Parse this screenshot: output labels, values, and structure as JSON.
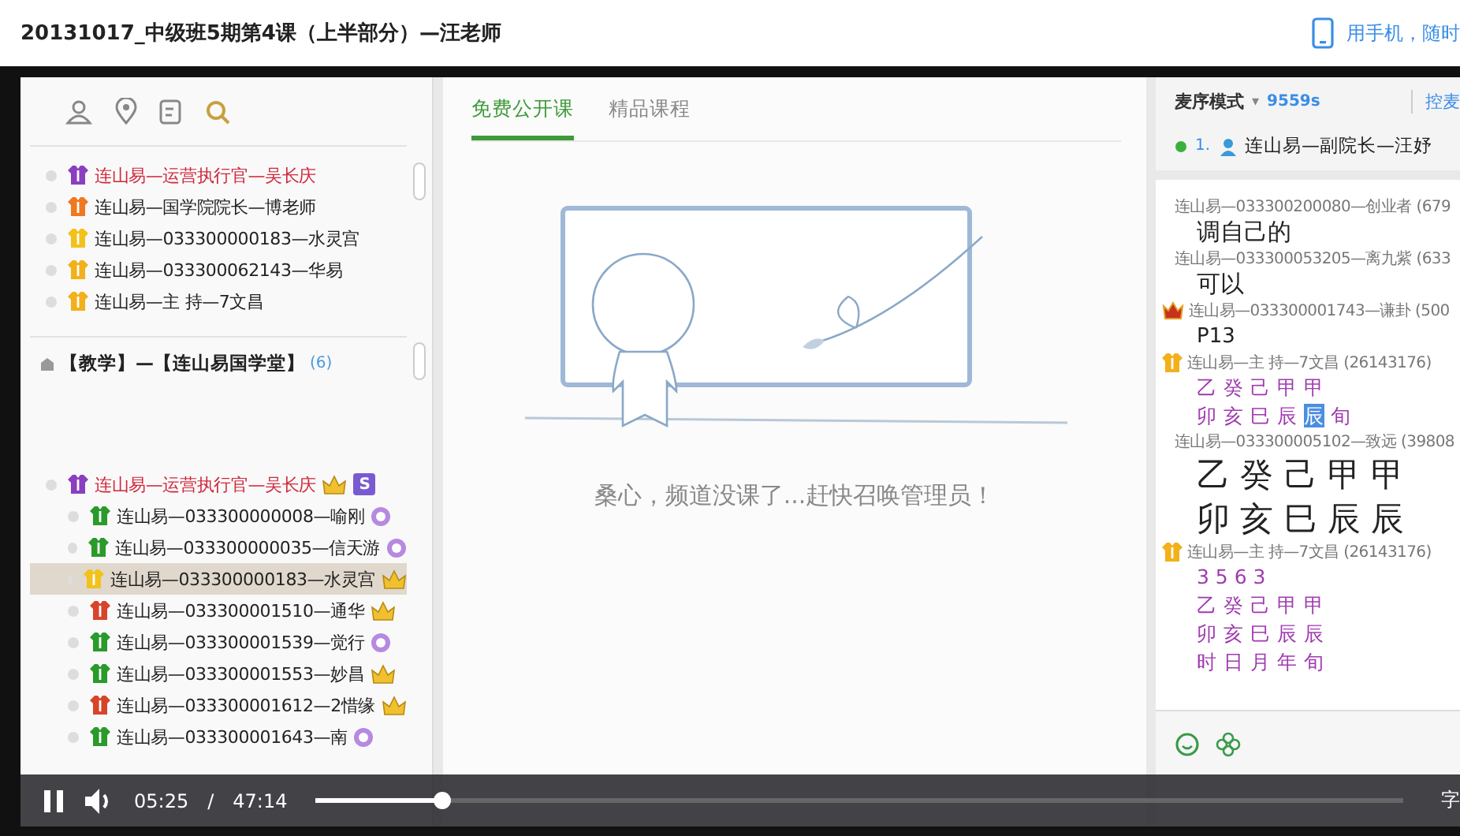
{
  "window": {
    "title": "20131017_中级班5期第4课（上半部分）—汪老师",
    "mobile_link": "用手机，随时"
  },
  "left_panel": {
    "group_1": [
      {
        "name": "连山易—运营执行官—吴长庆",
        "color": "#8a3fc0",
        "admin": true,
        "selected": false
      },
      {
        "name": "连山易—国学院院长—博老师",
        "color": "#f07820",
        "admin": false,
        "selected": false
      },
      {
        "name": "连山易—033300000183—水灵宫",
        "color": "#f2c21a",
        "admin": false,
        "selected": false
      },
      {
        "name": "连山易—033300062143—华易",
        "color": "#f2b01a",
        "admin": false,
        "selected": false
      },
      {
        "name": "连山易—主 持—7文昌",
        "color": "#f2b01a",
        "admin": false,
        "selected": false
      }
    ],
    "section": {
      "title": "【教学】—【连山易国学堂】",
      "count": "(6)"
    },
    "group_2": [
      {
        "name": "连山易—运营执行官—吴长庆",
        "color": "#8a3fc0",
        "admin": true,
        "selected": false,
        "badges": [
          {
            "kind": "crown"
          },
          {
            "kind": "letter",
            "text": "S"
          }
        ]
      },
      {
        "name": "连山易—033300000008—喻刚",
        "color": "#2a9a2a",
        "admin": false,
        "selected": false,
        "badges": [
          {
            "kind": "medal"
          }
        ]
      },
      {
        "name": "连山易—033300000035—信天游",
        "color": "#2a9a2a",
        "admin": false,
        "selected": false,
        "badges": [
          {
            "kind": "medal"
          }
        ]
      },
      {
        "name": "连山易—033300000183—水灵宫",
        "color": "#f2c21a",
        "admin": false,
        "selected": true,
        "badges": [
          {
            "kind": "crown"
          }
        ]
      },
      {
        "name": "连山易—033300001510—通华",
        "color": "#d8442a",
        "admin": false,
        "selected": false,
        "badges": [
          {
            "kind": "crown"
          }
        ]
      },
      {
        "name": "连山易—033300001539—觉行",
        "color": "#2a9a2a",
        "admin": false,
        "selected": false,
        "badges": [
          {
            "kind": "medal"
          }
        ]
      },
      {
        "name": "连山易—033300001553—妙昌",
        "color": "#2a9a2a",
        "admin": false,
        "selected": false,
        "badges": [
          {
            "kind": "crown"
          }
        ]
      },
      {
        "name": "连山易—033300001612—2惜缘",
        "color": "#d8442a",
        "admin": false,
        "selected": false,
        "badges": [
          {
            "kind": "crown"
          }
        ]
      },
      {
        "name": "连山易—033300001643—南",
        "color": "#2a9a2a",
        "admin": false,
        "selected": false,
        "badges": [
          {
            "kind": "medal"
          }
        ]
      }
    ]
  },
  "center": {
    "tabs": [
      {
        "label": "免费公开课",
        "selected": true
      },
      {
        "label": "精品课程",
        "selected": false
      }
    ],
    "empty_message": "桑心，频道没课了...赶快召唤管理员！"
  },
  "right_panel": {
    "mode": "麦序模式",
    "mode_caret": "▾",
    "timer": "9559s",
    "control": "控麦",
    "speaker": {
      "rank": "1.",
      "name": "连山易—副院长—汪妤"
    },
    "messages": [
      {
        "kind": "plain",
        "sender": "连山易—033300200080—创业者 (679",
        "lines": [
          {
            "kind": "large",
            "text": "调自己的"
          }
        ]
      },
      {
        "kind": "plain",
        "sender": "连山易—033300053205—离九紫 (633",
        "lines": [
          {
            "kind": "large",
            "text": "可以"
          }
        ]
      },
      {
        "kind": "crown",
        "sender": "连山易—033300001743—谦卦 (500",
        "lines": [
          {
            "kind": "plain",
            "text": "P13"
          }
        ]
      },
      {
        "kind": "vest",
        "sender": "连山易—主 持—7文昌 (26143176)",
        "lines": [
          {
            "kind": "purple",
            "text": "乙 癸 己 甲 甲"
          },
          {
            "kind": "purple",
            "parts": [
              {
                "text": "卯 亥 巳 辰 ",
                "highlighted": false
              },
              {
                "text": "辰",
                "highlighted": true
              },
              {
                "text": " 旬",
                "highlighted": false
              }
            ]
          }
        ]
      },
      {
        "kind": "plain",
        "sender": "连山易—033300005102—致远 (39808",
        "lines": [
          {
            "kind": "huge",
            "text": "乙 癸 己 甲 甲"
          },
          {
            "kind": "huge",
            "text": "卯 亥 巳 辰 辰"
          }
        ]
      },
      {
        "kind": "vest",
        "sender": "连山易—主 持—7文昌 (26143176)",
        "lines": [
          {
            "kind": "purple",
            "text": "3 5 6 3"
          },
          {
            "kind": "purple",
            "text": "乙 癸 己 甲 甲"
          },
          {
            "kind": "purple",
            "text": "卯 亥 巳 辰 辰"
          },
          {
            "kind": "purple",
            "text": "时 日 月 年 旬"
          }
        ]
      }
    ]
  },
  "player": {
    "playing": true,
    "current": "05:25",
    "separator": "/",
    "duration": "47:14",
    "progress": {
      "level": 0.115
    },
    "subtitles": "字"
  }
}
